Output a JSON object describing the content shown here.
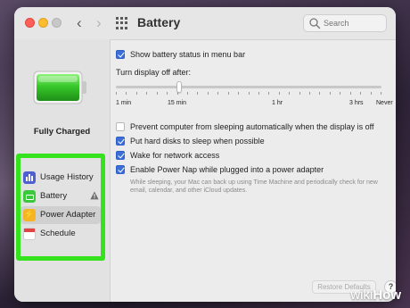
{
  "window": {
    "title": "Battery",
    "search_placeholder": "Search"
  },
  "sidebar": {
    "status": "Fully Charged",
    "items": [
      {
        "label": "Usage History",
        "icon": "usage-history-icon"
      },
      {
        "label": "Battery",
        "icon": "battery-icon"
      },
      {
        "label": "Power Adapter",
        "icon": "power-adapter-icon",
        "selected": true
      },
      {
        "label": "Schedule",
        "icon": "schedule-icon"
      }
    ]
  },
  "main": {
    "show_status": {
      "label": "Show battery status in menu bar",
      "checked": true
    },
    "display_off_label": "Turn display off after:",
    "slider": {
      "tick_labels": [
        "1 min",
        "15 min",
        "1 hr",
        "3 hrs",
        "Never"
      ]
    },
    "prevent_sleep": {
      "label": "Prevent computer from sleeping automatically when the display is off",
      "checked": false
    },
    "hard_disks": {
      "label": "Put hard disks to sleep when possible",
      "checked": true
    },
    "wake_network": {
      "label": "Wake for network access",
      "checked": true
    },
    "power_nap": {
      "label": "Enable Power Nap while plugged into a power adapter",
      "checked": true
    },
    "power_nap_desc": "While sleeping, your Mac can back up using Time Machine and periodically check for new email, calendar, and other iCloud updates.",
    "restore_defaults": "Restore Defaults",
    "help": "?"
  },
  "watermark": {
    "part1": "wiki",
    "part2": "How"
  },
  "colors": {
    "highlight": "#35e21e",
    "checkbox_on": "#3a6fd8",
    "battery_green": "#3cc83c"
  }
}
